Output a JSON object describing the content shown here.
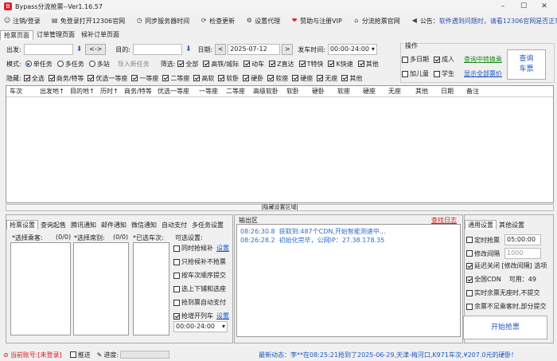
{
  "window": {
    "title": "Bypass分流抢票--Ver1.16.57",
    "app_icon_glyph": "B"
  },
  "menu": [
    {
      "icon": "user-icon",
      "glyph": "☺",
      "label": "注销/登录"
    },
    {
      "icon": "page-icon",
      "glyph": "▤",
      "label": "免登录打开12306官网"
    },
    {
      "icon": "clock-icon",
      "glyph": "◷",
      "label": "同步服务器时间"
    },
    {
      "icon": "refresh-icon",
      "glyph": "⟳",
      "label": "检查更新"
    },
    {
      "icon": "gear-icon",
      "glyph": "⚙",
      "label": "设置代理"
    },
    {
      "icon": "heart-icon",
      "glyph": "❤",
      "label": "赞助与注册VIP"
    },
    {
      "icon": "home-icon",
      "glyph": "⌂",
      "label": "分流抢票官网"
    },
    {
      "icon": "speaker-icon",
      "glyph": "◀",
      "label": "公告：",
      "notice": "软件遇到问题时，请看12306官网是否正常!"
    }
  ],
  "tabs": [
    "抢票页面",
    "订单管理页面",
    "候补订单页面"
  ],
  "query": {
    "from_label": "出发:",
    "to_label": "目的:",
    "swap": "<->",
    "date_label": "日期:",
    "date_value": "2025-07-12",
    "prev": "<",
    "next": ">",
    "time_label": "发车时间:",
    "time_value": "00:00-24:00",
    "dropdown_glyph": "▾",
    "down_glyph": "⬇"
  },
  "mode": {
    "label": "模式:",
    "options": [
      "单任务",
      "多任务",
      "多站"
    ],
    "selected": "单任务",
    "import_label": "导入新任务"
  },
  "filter": {
    "label": "筛选:",
    "items": [
      "全部",
      "高铁/城际",
      "动车",
      "Z直达",
      "T特快",
      "K快速",
      "其他"
    ]
  },
  "hide": {
    "label": "隐藏:",
    "items": [
      "全选",
      "商务/特等",
      "优选一等座",
      "一等座",
      "二等座",
      "高软",
      "软卧",
      "硬卧",
      "软座",
      "硬座",
      "无座",
      "其他"
    ]
  },
  "ops": {
    "title": "操作",
    "row1": [
      {
        "label": "多日期",
        "checked": false
      },
      {
        "label": "成人",
        "checked": true
      }
    ],
    "row2": [
      {
        "label": "加儿童",
        "checked": false
      },
      {
        "label": "学生",
        "checked": false
      }
    ],
    "link_transfer": "查询中转换乘",
    "link_price": "显示全部票价",
    "query_button": [
      "查询",
      "车票"
    ]
  },
  "columns": [
    "车次",
    "出发地↑",
    "目的地↑",
    "历时↑",
    "商务/特等",
    "优选一等座",
    "一等座",
    "二等座",
    "高级软卧",
    "软卧",
    "硬卧",
    "软座",
    "硬座",
    "无座",
    "其他",
    "日期",
    "备注"
  ],
  "hide_bar": "|隐藏设置区域|",
  "left_panel": {
    "tabs": [
      "抢票设置",
      "查询起售",
      "腾讯通知",
      "邮件通知",
      "微信通知",
      "自动支付",
      "多任务设置"
    ],
    "passengers_label": "*选择乘客:",
    "passengers_count": "(0/0)",
    "seats_label": "*选择席别:",
    "seats_count": "(0/0)",
    "selected_trains_label": "*已选车次:",
    "options_label": "可选设置:",
    "options": [
      {
        "label": "同时抢候补",
        "checked": false,
        "link": "设置"
      },
      {
        "label": "只抢候补不抢票",
        "checked": false
      },
      {
        "label": "按车次顺序提交",
        "checked": false
      },
      {
        "label": "选上下铺和选座",
        "checked": false
      },
      {
        "label": "抢到票自动支付",
        "checked": false
      },
      {
        "label": "抢增开列车",
        "checked": true,
        "link": "设置"
      }
    ],
    "time_range": "00:00-24:00"
  },
  "output": {
    "title": "输出区",
    "find_log": "查找日志",
    "lines": [
      {
        "time": "08:26:30.8",
        "text": "获取到:487个CDN,开始智能测速中..."
      },
      {
        "time": "08:26:28.2",
        "text": "初始化完毕，公网IP：27.38.178.35"
      }
    ]
  },
  "right_panel": {
    "tabs": [
      "通用设置",
      "其他设置"
    ],
    "items": [
      {
        "label": "定时抢票",
        "checked": false,
        "value": "05:00:00"
      },
      {
        "label": "修改间隔",
        "checked": false,
        "value": "1000"
      },
      {
        "label": "延迟关闭 [修改间隔] 选项",
        "checked": true
      },
      {
        "label": "全国CDN",
        "checked": true,
        "extra": "可用：49"
      },
      {
        "label": "实时余票无座时,不提交",
        "checked": false
      },
      {
        "label": "余票不足乘客时,部分提交",
        "checked": false
      }
    ],
    "start_button": "开始抢票"
  },
  "status": {
    "account": "当前账号:[未登录]",
    "push": "推送",
    "progress_label": "进度:",
    "progress": 0,
    "news": "最新动态：李**在08:25:21抢到了2025-06-29,天津-梅河口,K971车次,¥207.0元的硬卧!"
  }
}
